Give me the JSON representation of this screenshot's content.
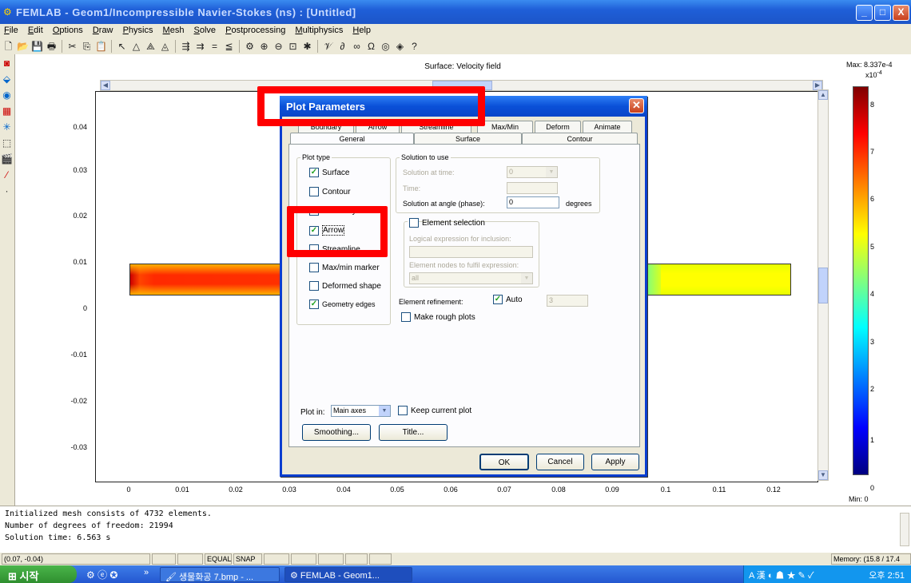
{
  "window": {
    "title": "FEMLAB - Geom1/Incompressible Navier-Stokes (ns) : [Untitled]",
    "minimize": "_",
    "maximize": "□",
    "close": "X"
  },
  "menu": [
    "File",
    "Edit",
    "Options",
    "Draw",
    "Physics",
    "Mesh",
    "Solve",
    "Postprocessing",
    "Multiphysics",
    "Help"
  ],
  "plot": {
    "title": "Surface: Velocity field",
    "y_ticks": [
      "0.04",
      "0.03",
      "0.02",
      "0.01",
      "0",
      "-0.01",
      "-0.02",
      "-0.03"
    ],
    "x_ticks": [
      "0",
      "0.01",
      "0.02",
      "0.03",
      "0.04",
      "0.05",
      "0.06",
      "0.07",
      "0.08",
      "0.09",
      "0.1",
      "0.11",
      "0.12"
    ],
    "colorbar": {
      "max_label": "Max: 8.337e-4",
      "exponent": "x10",
      "exponent_power": "-4",
      "ticks": [
        "8",
        "7",
        "6",
        "5",
        "4",
        "3",
        "2",
        "1",
        "0"
      ],
      "min_label": "Min: 0"
    }
  },
  "log": [
    "Initialized mesh consists of 4732 elements.",
    "Number of degrees of freedom: 21994",
    "Solution time: 6.563 s"
  ],
  "statusbar": {
    "coords": "(0.07, -0.04)",
    "equal": "EQUAL",
    "snap": "SNAP",
    "memory": "Memory: (15.8 / 17.4"
  },
  "taskbar": {
    "start": "시작",
    "items": [
      "생물화공 7.bmp - ...",
      "FEMLAB - Geom1..."
    ],
    "tray_lang": "A 漢",
    "clock": "오후 2:51"
  },
  "dialog": {
    "title": "Plot Parameters",
    "tabs_back": [
      "Boundary",
      "Arrow",
      "Streamline",
      "Max/Min",
      "Deform",
      "Animate"
    ],
    "tabs_front": [
      "General",
      "Surface",
      "Contour"
    ],
    "plot_type": {
      "legend": "Plot type",
      "items": [
        {
          "label": "Surface",
          "checked": true
        },
        {
          "label": "Contour",
          "checked": false
        },
        {
          "label": "Boundary",
          "checked": false
        },
        {
          "label": "Arrow",
          "checked": true
        },
        {
          "label": "Streamline",
          "checked": false
        },
        {
          "label": "Max/min marker",
          "checked": false
        },
        {
          "label": "Deformed shape",
          "checked": false
        },
        {
          "label": "Geometry edges",
          "checked": true
        }
      ]
    },
    "solution": {
      "legend": "Solution to use",
      "time_label": "Solution at time:",
      "time_value": "0",
      "time_field_label": "Time:",
      "angle_label": "Solution at angle (phase):",
      "angle_value": "0",
      "angle_unit": "degrees"
    },
    "element_selection": {
      "legend": "Element selection",
      "logical_label": "Logical expression for inclusion:",
      "nodes_label": "Element nodes to fulfil expression:",
      "nodes_value": "all"
    },
    "refinement": {
      "label": "Element refinement:",
      "auto_label": "Auto",
      "value": "3",
      "rough_label": "Make rough plots"
    },
    "plot_in_label": "Plot in:",
    "plot_in_value": "Main axes",
    "keep_label": "Keep current plot",
    "smoothing_button": "Smoothing...",
    "title_button": "Title...",
    "ok": "OK",
    "cancel": "Cancel",
    "apply": "Apply"
  },
  "colors": {
    "titlebar": "#1f5fd8",
    "highlight": "#ff0000",
    "check": "#21a121"
  }
}
